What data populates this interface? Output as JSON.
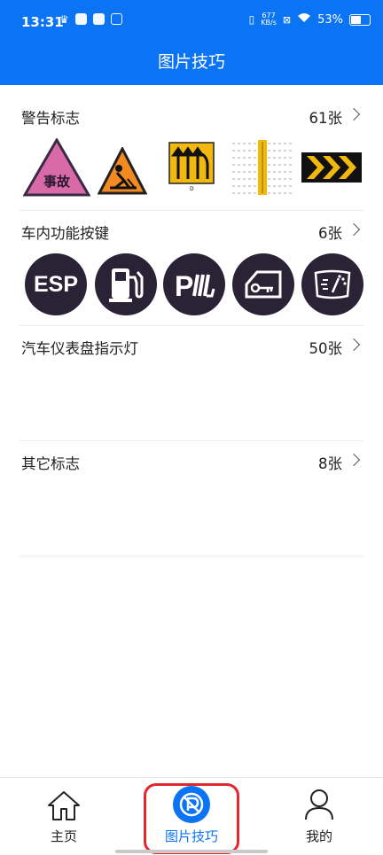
{
  "status_bar": {
    "time": "13:31",
    "net_speed": "677",
    "net_unit": "KB/s",
    "battery": "53%"
  },
  "header": {
    "title": "图片技巧"
  },
  "sections": [
    {
      "title": "警告标志",
      "count": "61张",
      "sign_text": "事故"
    },
    {
      "title": "车内功能按键",
      "count": "6张",
      "buttons": [
        "ESP"
      ]
    },
    {
      "title": "汽车仪表盘指示灯",
      "count": "50张"
    },
    {
      "title": "其它标志",
      "count": "8张"
    }
  ],
  "tabs": [
    {
      "label": "主页",
      "icon": "home-icon"
    },
    {
      "label": "图片技巧",
      "icon": "picture-tips-icon"
    },
    {
      "label": "我的",
      "icon": "user-icon"
    }
  ],
  "colors": {
    "primary": "#0b74f5",
    "highlight": "#e0282e",
    "button_bg": "#2a2235"
  }
}
